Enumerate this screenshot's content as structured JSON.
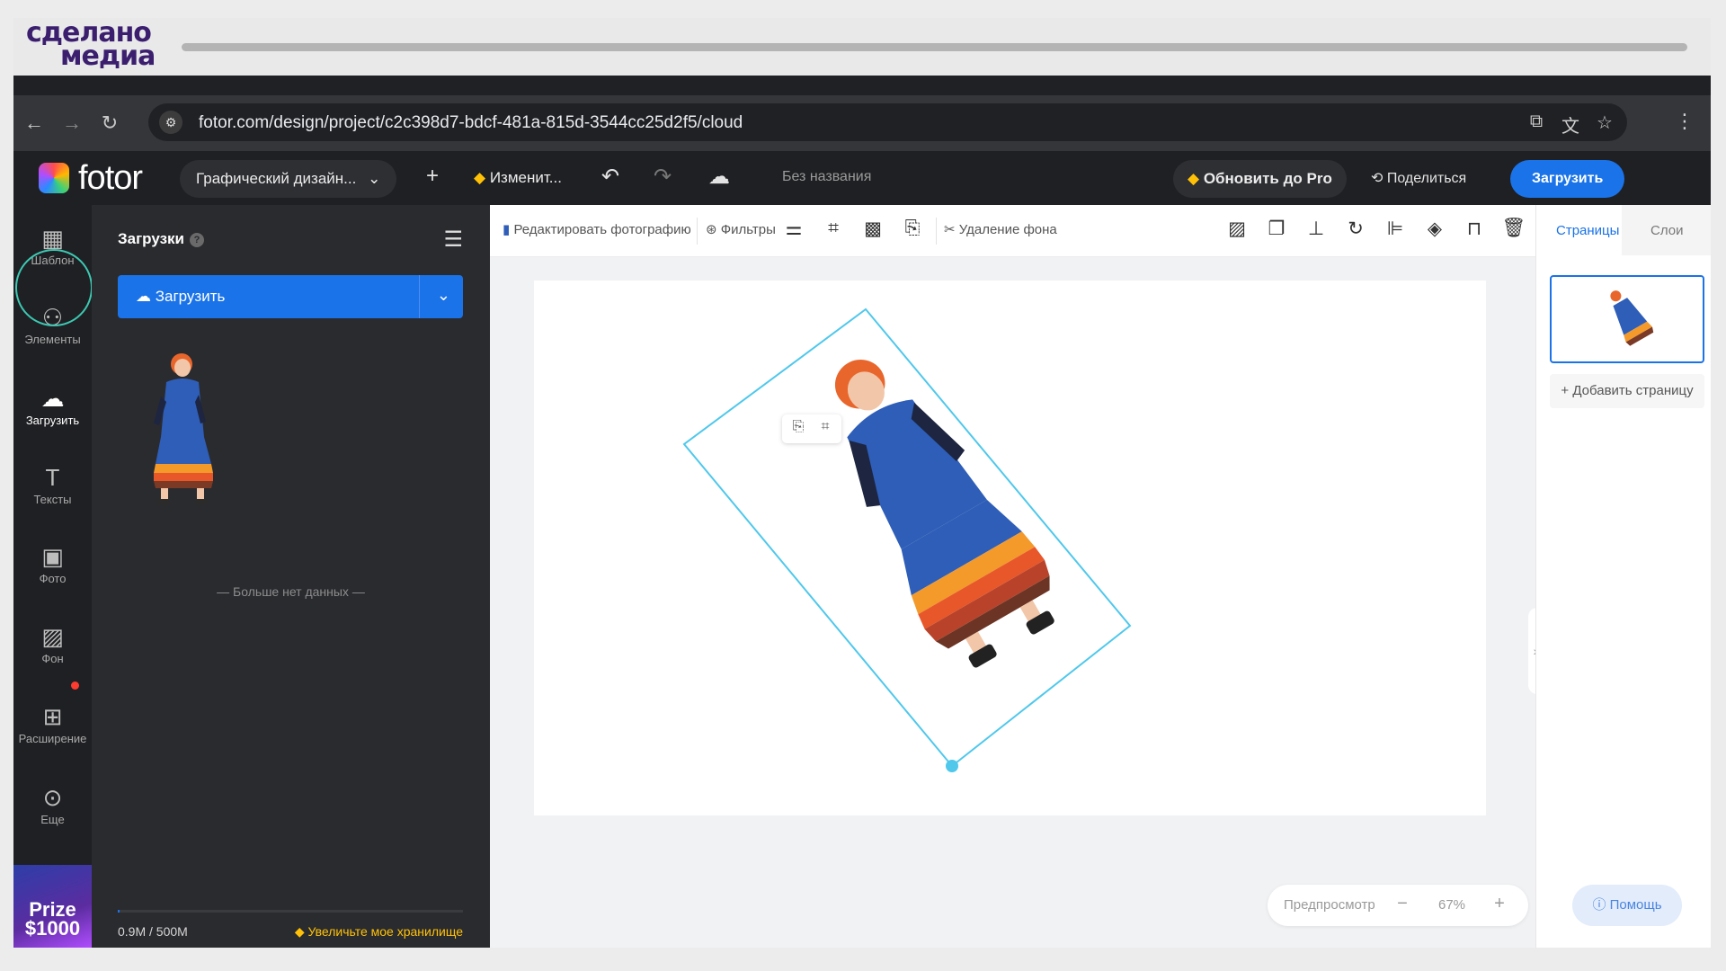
{
  "branding": {
    "logo_line1": "сделано",
    "logo_line2": "медиа"
  },
  "browser": {
    "url": "fotor.com/design/project/c2c398d7-bdcf-481a-815d-3544cc25d2f5/cloud",
    "back_icon": "arrow-left-icon",
    "forward_icon": "arrow-right-icon",
    "reload_icon": "reload-icon"
  },
  "header": {
    "logo": "fotor",
    "design_type": "Графический дизайн...",
    "change_label": "Изменит...",
    "title": "Без названия",
    "upgrade_label": "Обновить до Pro",
    "share_label": "Поделиться",
    "download_label": "Загрузить"
  },
  "rail": {
    "items": [
      {
        "label": "Шаблон"
      },
      {
        "label": "Элементы"
      },
      {
        "label": "Загрузить"
      },
      {
        "label": "Тексты"
      },
      {
        "label": "Фото"
      },
      {
        "label": "Фон"
      },
      {
        "label": "Расширение"
      },
      {
        "label": "Еще"
      }
    ],
    "promo_line1": "Prize",
    "promo_line2": "$1000"
  },
  "uploads": {
    "title": "Загрузки",
    "upload_button": "Загрузить",
    "no_more": "— Больше нет данных —",
    "storage_used": "0.9M / 500M",
    "storage_upgrade": "Увеличьте мое хранилище",
    "storage_fraction": 0.0018
  },
  "toolbar": {
    "edit_photo": "Редактировать фотографию",
    "filters": "Фильтры",
    "remove_bg": "Удаление фона"
  },
  "canvas": {
    "preview": "Предпросмотр",
    "zoom": "67%"
  },
  "pages": {
    "tab_pages": "Страницы",
    "tab_layers": "Слои",
    "add_page": "+ Добавить страницу",
    "help": "Помощь"
  },
  "colors": {
    "accent": "#1a73e8",
    "selection": "#4fc8ec",
    "dark_bg": "#1f2023",
    "panel_bg": "#2a2b2f",
    "gold": "#ffc107"
  }
}
